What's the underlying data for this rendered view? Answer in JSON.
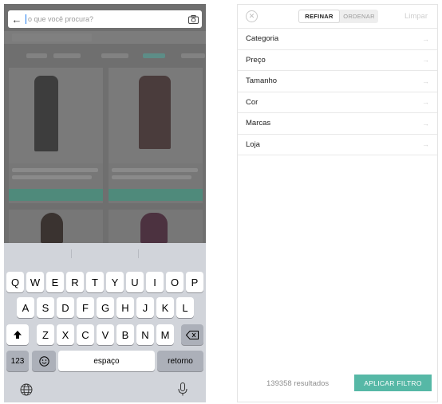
{
  "search": {
    "placeholder": "o que você procura?",
    "back_icon": "arrow-left-icon",
    "camera_icon": "camera-icon"
  },
  "keyboard": {
    "row1": [
      "Q",
      "W",
      "E",
      "R",
      "T",
      "Y",
      "U",
      "I",
      "O",
      "P"
    ],
    "row2": [
      "A",
      "S",
      "D",
      "F",
      "G",
      "H",
      "J",
      "K",
      "L"
    ],
    "row3": [
      "Z",
      "X",
      "C",
      "V",
      "B",
      "N",
      "M"
    ],
    "numbers_key": "123",
    "space_key": "espaço",
    "return_key": "retorno",
    "shift_icon": "shift-icon",
    "backspace_icon": "backspace-icon",
    "emoji_icon": "emoji-icon",
    "globe_icon": "globe-icon",
    "mic_icon": "microphone-icon"
  },
  "filter": {
    "tabs": {
      "refinar": "REFINAR",
      "ordenar": "ORDENAR"
    },
    "clear_label": "Limpar",
    "close_icon": "close-icon",
    "items": [
      {
        "label": "Categoria",
        "icon": "arrow-right-icon"
      },
      {
        "label": "Preço",
        "icon": "arrow-right-icon"
      },
      {
        "label": "Tamanho",
        "icon": "arrow-right-icon"
      },
      {
        "label": "Cor",
        "icon": "arrow-right-icon"
      },
      {
        "label": "Marcas",
        "icon": "arrow-right-icon"
      },
      {
        "label": "Loja",
        "icon": "arrow-right-icon"
      }
    ],
    "results_text": "139358 resultados",
    "apply_label": "APLICAR FILTRO"
  },
  "colors": {
    "accent": "#56b8a6",
    "overlay": "#6f6f6f",
    "keyboard_bg": "#d1d4da"
  }
}
